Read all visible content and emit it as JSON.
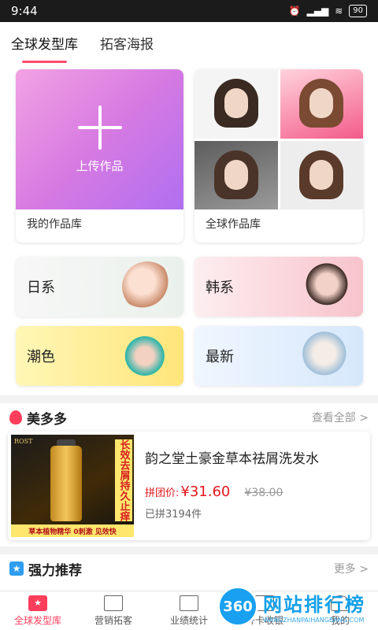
{
  "status_bar": {
    "time": "9:44",
    "battery": "90",
    "signal": "signal",
    "wifi": "wifi",
    "alarm": "alarm"
  },
  "top_tabs": [
    {
      "label": "全球发型库",
      "active": true
    },
    {
      "label": "拓客海报",
      "active": false
    }
  ],
  "upload_card": {
    "button_label": "上传作品",
    "caption": "我的作品库"
  },
  "global_card": {
    "caption": "全球作品库"
  },
  "categories": [
    {
      "label": "日系"
    },
    {
      "label": "韩系"
    },
    {
      "label": "潮色"
    },
    {
      "label": "最新"
    }
  ],
  "meiduoduo": {
    "title": "美多多",
    "more": "查看全部 >"
  },
  "product": {
    "name": "韵之堂土豪金草本祛屑洗发水",
    "price_label": "拼团价:",
    "price": "¥31.60",
    "original_price": "¥38.00",
    "sold": "已拼3194件",
    "image_brand": "ROST",
    "image_banner": "长效去屑持久止痒",
    "image_footer": "草本植物精华 0刺激 见效快"
  },
  "recommend": {
    "title": "强力推荐",
    "more": "更多 >"
  },
  "bottom_nav": [
    {
      "label": "全球发型库",
      "active": true
    },
    {
      "label": "营销拓客",
      "active": false
    },
    {
      "label": "业绩统计",
      "active": false
    },
    {
      "label": "开卡收银",
      "active": false
    },
    {
      "label": "我的",
      "active": false
    }
  ],
  "watermark": {
    "logo": "360",
    "main": "网站排行榜",
    "sub": "WANGZHANPAIHANGBANG.COM"
  },
  "colors": {
    "accent": "#ff3e5c",
    "price": "#e4181e"
  }
}
